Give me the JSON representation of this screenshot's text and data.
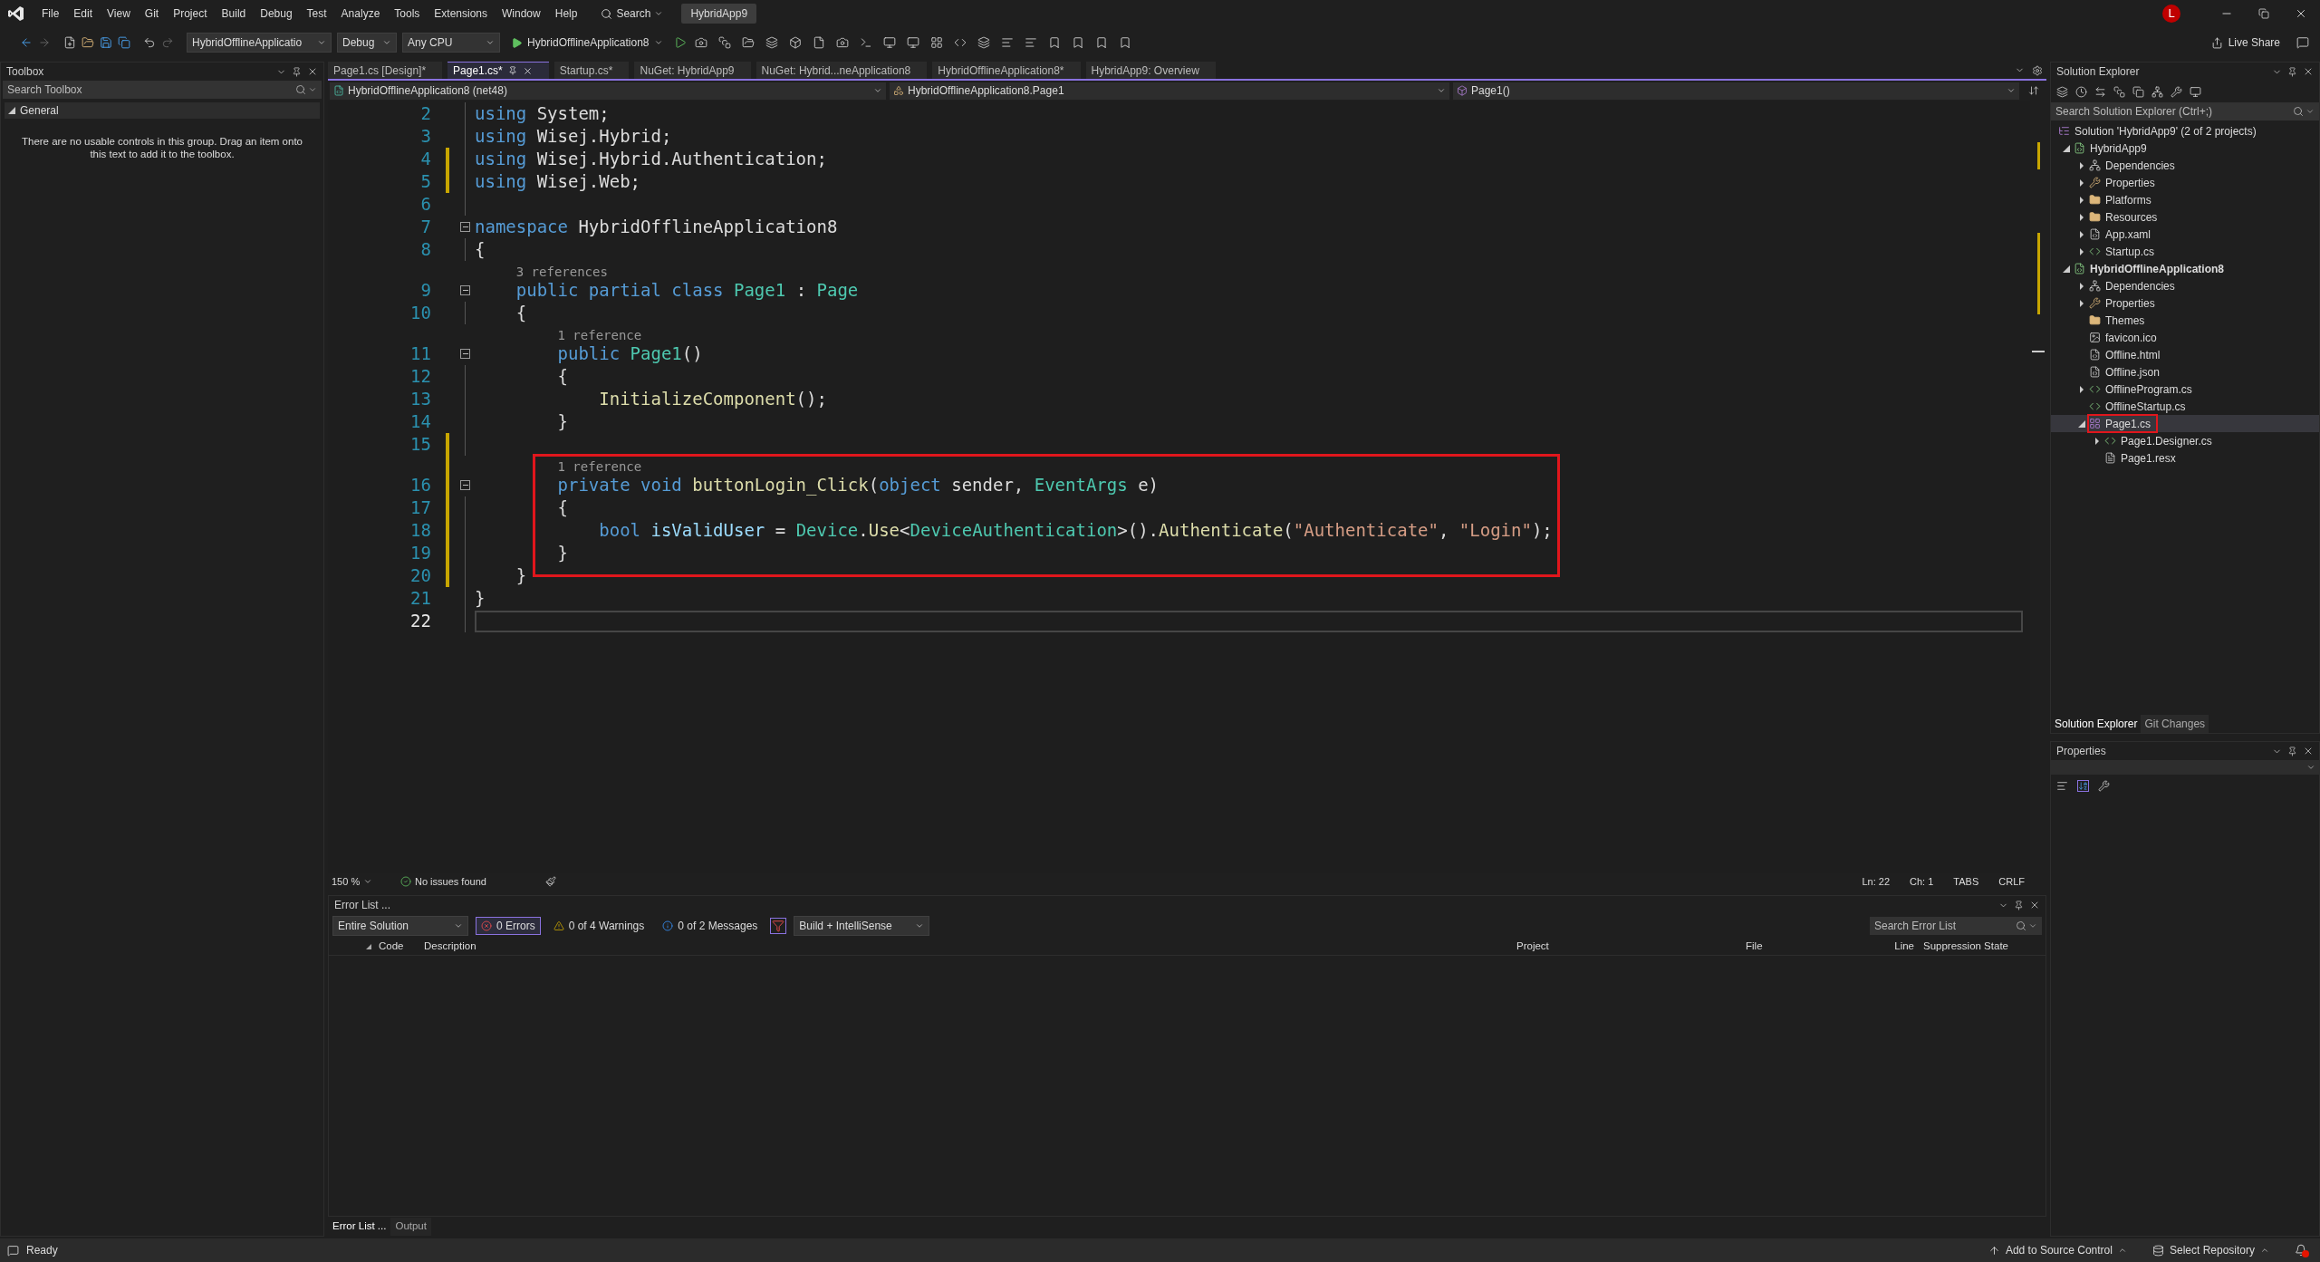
{
  "menu_bar": {
    "items": [
      "File",
      "Edit",
      "View",
      "Git",
      "Project",
      "Build",
      "Debug",
      "Test",
      "Analyze",
      "Tools",
      "Extensions",
      "Window",
      "Help"
    ],
    "search": "Search",
    "solution_name": "HybridApp9",
    "avatar": "L"
  },
  "toolbar": {
    "startup_project": "HybridOfflineApplicatio",
    "configuration": "Debug",
    "platform": "Any CPU",
    "run_target": "HybridOfflineApplication8",
    "live_share": "Live Share"
  },
  "toolbox": {
    "title": "Toolbox",
    "search": {
      "placeholder": "Search Toolbox"
    },
    "groups": [
      {
        "label": "General",
        "expanded": true,
        "message": "There are no usable controls in this group. Drag an item onto this text to add it to the toolbox."
      }
    ]
  },
  "editor": {
    "tabs": [
      {
        "label": "Page1.cs [Design]*",
        "selected": false
      },
      {
        "label": "Page1.cs*",
        "selected": true
      },
      {
        "label": "Startup.cs*",
        "selected": false
      },
      {
        "label": "NuGet: HybridApp9",
        "selected": false
      },
      {
        "label": "NuGet: Hybrid...neApplication8",
        "selected": false
      },
      {
        "label": "HybridOfflineApplication8*",
        "selected": false
      },
      {
        "label": "HybridApp9: Overview",
        "selected": false
      }
    ],
    "navigation": [
      "HybridOfflineApplication8 (net48)",
      "HybridOfflineApplication8.Page1",
      "Page1()"
    ],
    "lines": [
      {
        "kind": "code",
        "number": "2",
        "tokens": [
          {
            "text": "using",
            "kind": "kw"
          },
          {
            "text": " System;",
            "kind": "plain"
          }
        ],
        "changed": false,
        "foldable": false,
        "current": false
      },
      {
        "kind": "code",
        "number": "3",
        "tokens": [
          {
            "text": "using",
            "kind": "kw"
          },
          {
            "text": " Wisej.Hybrid;",
            "kind": "plain"
          }
        ],
        "changed": false,
        "foldable": false,
        "current": false
      },
      {
        "kind": "code",
        "number": "4",
        "tokens": [
          {
            "text": "using",
            "kind": "kw"
          },
          {
            "text": " Wisej.Hybrid.Authentication;",
            "kind": "plain"
          }
        ],
        "changed": true,
        "foldable": false,
        "current": false
      },
      {
        "kind": "code",
        "number": "5",
        "tokens": [
          {
            "text": "using",
            "kind": "kw"
          },
          {
            "text": " Wisej.Web;",
            "kind": "plain"
          }
        ],
        "changed": true,
        "foldable": false,
        "current": false
      },
      {
        "kind": "code",
        "number": "6",
        "changed": false,
        "foldable": false,
        "current": false
      },
      {
        "kind": "code",
        "number": "7",
        "tokens": [
          {
            "text": "namespace",
            "kind": "kw"
          },
          {
            "text": " HybridOfflineApplication8",
            "kind": "plain"
          }
        ],
        "changed": false,
        "foldable": true,
        "current": false
      },
      {
        "kind": "code",
        "number": "8",
        "tokens": [
          {
            "text": "{",
            "kind": "plain"
          }
        ],
        "changed": false,
        "foldable": false,
        "current": false
      },
      {
        "kind": "codelens",
        "text": "    3 references",
        "changed": false
      },
      {
        "kind": "code",
        "number": "9",
        "tokens": [
          {
            "text": "    public partial class",
            "kind": "kw"
          },
          {
            "text": " Page1",
            "kind": "type"
          },
          {
            "text": " : ",
            "kind": "plain"
          },
          {
            "text": "Page",
            "kind": "type"
          }
        ],
        "changed": false,
        "foldable": true,
        "current": false
      },
      {
        "kind": "code",
        "number": "10",
        "tokens": [
          {
            "text": "    {",
            "kind": "plain"
          }
        ],
        "changed": false,
        "foldable": false,
        "current": false
      },
      {
        "kind": "codelens",
        "text": "        1 reference",
        "changed": false
      },
      {
        "kind": "code",
        "number": "11",
        "tokens": [
          {
            "text": "        public",
            "kind": "kw"
          },
          {
            "text": " Page1",
            "kind": "type"
          },
          {
            "text": "()",
            "kind": "plain"
          }
        ],
        "changed": false,
        "foldable": true,
        "current": false
      },
      {
        "kind": "code",
        "number": "12",
        "tokens": [
          {
            "text": "        {",
            "kind": "plain"
          }
        ],
        "changed": false,
        "foldable": false,
        "current": false
      },
      {
        "kind": "code",
        "number": "13",
        "tokens": [
          {
            "text": "            InitializeComponent",
            "kind": "method"
          },
          {
            "text": "();",
            "kind": "plain"
          }
        ],
        "changed": false,
        "foldable": false,
        "current": false
      },
      {
        "kind": "code",
        "number": "14",
        "tokens": [
          {
            "text": "        }",
            "kind": "plain"
          }
        ],
        "changed": false,
        "foldable": false,
        "current": false
      },
      {
        "kind": "code",
        "number": "15",
        "changed": true,
        "foldable": false,
        "current": false
      },
      {
        "kind": "highlight",
        "lines": [
          {
            "kind": "codelens",
            "text": "        1 reference",
            "changed": true
          },
          {
            "kind": "code",
            "number": "16",
            "tokens": [
              {
                "text": "        private void",
                "kind": "kw"
              },
              {
                "text": " buttonLogin_Click",
                "kind": "method"
              },
              {
                "text": "(",
                "kind": "plain"
              },
              {
                "text": "object",
                "kind": "kw"
              },
              {
                "text": " sender, ",
                "kind": "plain"
              },
              {
                "text": "EventArgs",
                "kind": "type"
              },
              {
                "text": " e)",
                "kind": "plain"
              }
            ],
            "changed": true,
            "foldable": true,
            "current": false
          },
          {
            "kind": "code",
            "number": "17",
            "tokens": [
              {
                "text": "        {",
                "kind": "plain"
              }
            ],
            "changed": true,
            "foldable": false,
            "current": false
          },
          {
            "kind": "code",
            "number": "18",
            "tokens": [
              {
                "text": "            bool",
                "kind": "kw"
              },
              {
                "text": " isValidUser",
                "kind": "var"
              },
              {
                "text": " = ",
                "kind": "plain"
              },
              {
                "text": "Device",
                "kind": "type"
              },
              {
                "text": ".",
                "kind": "plain"
              },
              {
                "text": "Use",
                "kind": "method"
              },
              {
                "text": "<",
                "kind": "plain"
              },
              {
                "text": "DeviceAuthentication",
                "kind": "type"
              },
              {
                "text": ">().",
                "kind": "plain"
              },
              {
                "text": "Authenticate",
                "kind": "method"
              },
              {
                "text": "(",
                "kind": "plain"
              },
              {
                "text": "\"Authenticate\"",
                "kind": "string"
              },
              {
                "text": ", ",
                "kind": "plain"
              },
              {
                "text": "\"Login\"",
                "kind": "string"
              },
              {
                "text": ");",
                "kind": "plain"
              }
            ],
            "changed": true,
            "foldable": false,
            "current": false
          },
          {
            "kind": "code",
            "number": "19",
            "tokens": [
              {
                "text": "        }",
                "kind": "plain"
              }
            ],
            "changed": true,
            "foldable": false,
            "current": false
          }
        ]
      },
      {
        "kind": "code",
        "number": "20",
        "tokens": [
          {
            "text": "    }",
            "kind": "plain"
          }
        ],
        "changed": true,
        "foldable": false,
        "current": false
      },
      {
        "kind": "code",
        "number": "21",
        "tokens": [
          {
            "text": "}",
            "kind": "plain"
          }
        ],
        "changed": false,
        "foldable": false,
        "current": false
      },
      {
        "kind": "code",
        "number": "22",
        "changed": false,
        "foldable": false,
        "current": true
      }
    ],
    "zoom": "150 %",
    "issues": "No issues found",
    "position": [
      "Ln: 22",
      "Ch: 1"
    ],
    "indentation": "TABS",
    "line_endings": "CRLF"
  },
  "error_list": {
    "title": "Error List ...",
    "scope": "Entire Solution",
    "filters": [
      {
        "kind": "error",
        "label": "0 Errors",
        "selected": true
      },
      {
        "kind": "warning",
        "label": "0 of 4 Warnings",
        "selected": false
      },
      {
        "kind": "message",
        "label": "0 of 2 Messages",
        "selected": false
      }
    ],
    "source": "Build + IntelliSense",
    "search": {
      "placeholder": "Search Error List"
    },
    "columns": [
      "Code",
      "Description",
      "Project",
      "File",
      "Line",
      "Suppression State"
    ]
  },
  "bottom_tabs": [
    {
      "label": "Error List ...",
      "selected": true
    },
    {
      "label": "Output",
      "selected": false
    }
  ],
  "solution_explorer": {
    "title": "Solution Explorer",
    "search": {
      "placeholder": "Search Solution Explorer (Ctrl+;)"
    },
    "tree": [
      {
        "label": "Solution 'HybridApp9' (2 of 2 projects)",
        "kind": "solution",
        "selected": false,
        "outlined": false,
        "children": [
          {
            "label": "HybridApp9",
            "kind": "project",
            "expanded": true,
            "startup_project": false,
            "selected": false,
            "outlined": false,
            "children": [
              {
                "label": "Dependencies",
                "kind": "dependencies",
                "expanded": false,
                "selected": false,
                "outlined": false
              },
              {
                "label": "Properties",
                "kind": "properties",
                "expanded": false,
                "selected": false,
                "outlined": false
              },
              {
                "label": "Platforms",
                "kind": "folder",
                "expanded": false,
                "selected": false,
                "outlined": false
              },
              {
                "label": "Resources",
                "kind": "folder",
                "expanded": false,
                "selected": false,
                "outlined": false
              },
              {
                "label": "App.xaml",
                "kind": "markup",
                "expanded": false,
                "selected": false,
                "outlined": false
              },
              {
                "label": "Startup.cs",
                "kind": "csharp",
                "expanded": false,
                "selected": false,
                "outlined": false
              }
            ]
          },
          {
            "label": "HybridOfflineApplication8",
            "kind": "project",
            "expanded": true,
            "startup_project": true,
            "selected": false,
            "outlined": false,
            "children": [
              {
                "label": "Dependencies",
                "kind": "dependencies",
                "expanded": false,
                "selected": false,
                "outlined": false
              },
              {
                "label": "Properties",
                "kind": "properties",
                "expanded": false,
                "selected": false,
                "outlined": false
              },
              {
                "label": "Themes",
                "kind": "folder",
                "selected": false,
                "outlined": false
              },
              {
                "label": "favicon.ico",
                "kind": "image",
                "selected": false,
                "outlined": false
              },
              {
                "label": "Offline.html",
                "kind": "markup",
                "selected": false,
                "outlined": false
              },
              {
                "label": "Offline.json",
                "kind": "json",
                "selected": false,
                "outlined": false
              },
              {
                "label": "OfflineProgram.cs",
                "kind": "csharp",
                "expanded": false,
                "selected": false,
                "outlined": false
              },
              {
                "label": "OfflineStartup.cs",
                "kind": "csharp",
                "selected": false,
                "outlined": false
              },
              {
                "label": "Page1.cs",
                "kind": "form",
                "expanded": true,
                "selected": true,
                "outlined": true,
                "children": [
                  {
                    "label": "Page1.Designer.cs",
                    "kind": "csharp",
                    "expanded": false,
                    "selected": false,
                    "outlined": false
                  },
                  {
                    "label": "Page1.resx",
                    "kind": "resource",
                    "selected": false,
                    "outlined": false
                  }
                ]
              }
            ]
          }
        ]
      }
    ],
    "tabs": [
      {
        "label": "Solution Explorer",
        "selected": true
      },
      {
        "label": "Git Changes",
        "selected": false
      }
    ]
  },
  "properties": {
    "title": "Properties"
  },
  "status_bar": {
    "text": "Ready",
    "source_control": "Add to Source Control",
    "repository": "Select Repository",
    "unread_notifications": true
  }
}
